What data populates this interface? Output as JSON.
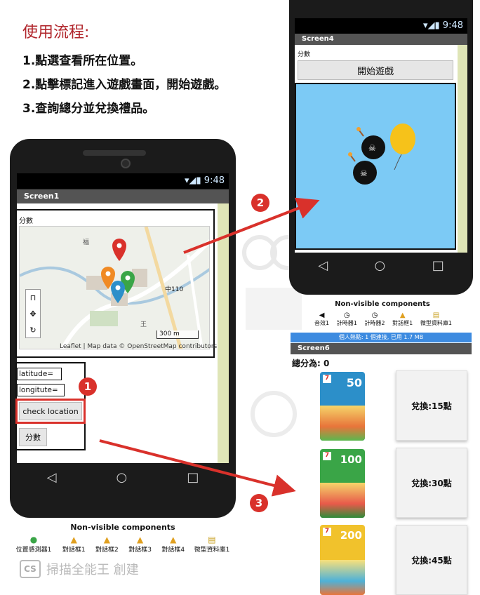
{
  "instructions": {
    "title": "使用流程:",
    "steps": [
      "1.點選查看所在位置。",
      "2.點擊標記進入遊戲畫面，開始遊戲。",
      "3.查詢總分並兌換禮品。"
    ]
  },
  "phone_left": {
    "status_time": "9:48",
    "screen_title": "Screen1",
    "score_label": "分數",
    "map_scale": "300 m",
    "map_road": "中110",
    "map_place_1": "福",
    "map_place_2": "王",
    "map_attribution": "Leaflet | Map data © OpenStreetMap contributors",
    "latitude_field": "latitude=",
    "longitude_field": "longitute=",
    "check_button": "check location",
    "score_button": "分數"
  },
  "phone_right": {
    "status_time": "9:48",
    "screen_title": "Screen4",
    "score_label": "分數",
    "start_button": "開始遊戲"
  },
  "nonvisible_right": {
    "title": "Non-visible components",
    "components": [
      "音效1",
      "計時器1",
      "計時器2",
      "對話框1",
      "微型資料庫1"
    ],
    "status_text": "個人熱點: 1 個連接, 已用 1.7 MB"
  },
  "nonvisible_left": {
    "title": "Non-visible components",
    "components": [
      "位置感測器1",
      "對話框1",
      "對話框2",
      "對話框3",
      "對話框4",
      "微型資料庫1"
    ]
  },
  "screen6": {
    "title": "Screen6",
    "total": "總分為: 0",
    "cards": [
      {
        "value": "50",
        "color": "#2c8fc9"
      },
      {
        "value": "100",
        "color": "#3aa547"
      },
      {
        "value": "200",
        "color": "#f1c22c"
      }
    ],
    "redeem": [
      "兌換:15點",
      "兌換:30點",
      "兌換:45點"
    ]
  },
  "badges": [
    "1",
    "2",
    "3"
  ],
  "watermark": "掃描全能王 創建",
  "watermark_logo": "CS",
  "colors": {
    "accent_red": "#d9312b",
    "title_red": "#b0242a",
    "game_bg": "#7ccaf5",
    "bar_blue": "#3d8be0"
  }
}
